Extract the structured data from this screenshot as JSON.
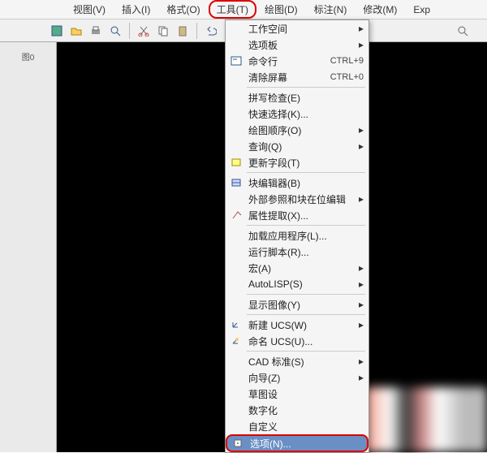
{
  "menubar": {
    "items": [
      {
        "label": "视图(V)"
      },
      {
        "label": "插入(I)"
      },
      {
        "label": "格式(O)"
      },
      {
        "label": "工具(T)",
        "highlighted": true
      },
      {
        "label": "绘图(D)"
      },
      {
        "label": "标注(N)"
      },
      {
        "label": "修改(M)"
      },
      {
        "label": "Exp"
      }
    ]
  },
  "toolbar": {
    "icons": [
      "save",
      "open",
      "print",
      "preview",
      "cut",
      "copy",
      "paste"
    ]
  },
  "tabs": {
    "label": "图0"
  },
  "dropdown": {
    "groups": [
      [
        {
          "label": "工作空间",
          "submenu": true
        },
        {
          "label": "选项板",
          "submenu": true
        },
        {
          "icon": "cmd",
          "label": "命令行",
          "shortcut": "CTRL+9"
        },
        {
          "label": "清除屏幕",
          "shortcut": "CTRL+0"
        }
      ],
      [
        {
          "label": "拼写检查(E)"
        },
        {
          "label": "快速选择(K)..."
        },
        {
          "label": "绘图顺序(O)",
          "submenu": true
        },
        {
          "label": "查询(Q)",
          "submenu": true
        },
        {
          "icon": "field",
          "label": "更新字段(T)"
        }
      ],
      [
        {
          "icon": "block",
          "label": "块编辑器(B)"
        },
        {
          "label": "外部参照和块在位编辑",
          "submenu": true
        },
        {
          "icon": "attr",
          "label": "属性提取(X)..."
        }
      ],
      [
        {
          "label": "加载应用程序(L)..."
        },
        {
          "label": "运行脚本(R)..."
        },
        {
          "label": "宏(A)",
          "submenu": true
        },
        {
          "label": "AutoLISP(S)",
          "submenu": true
        }
      ],
      [
        {
          "label": "显示图像(Y)",
          "submenu": true
        }
      ],
      [
        {
          "icon": "ucs",
          "label": "新建 UCS(W)",
          "submenu": true
        },
        {
          "icon": "ucsn",
          "label": "命名 UCS(U)..."
        }
      ],
      [
        {
          "label": "CAD 标准(S)",
          "submenu": true
        },
        {
          "label": "向导(Z)",
          "submenu": true
        },
        {
          "label": "草图设"
        },
        {
          "label": "数字化"
        },
        {
          "label": "自定义"
        },
        {
          "icon": "opt",
          "label": "选项(N)...",
          "highlighted": true
        }
      ]
    ]
  }
}
